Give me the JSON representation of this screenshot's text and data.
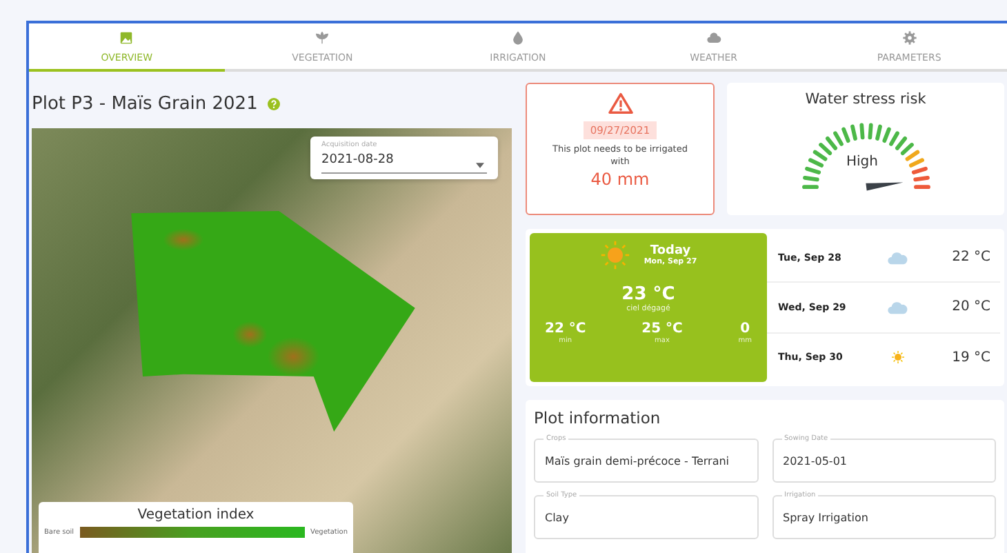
{
  "tabs": [
    {
      "label": "OVERVIEW",
      "selected": true
    },
    {
      "label": "VEGETATION",
      "selected": false
    },
    {
      "label": "IRRIGATION",
      "selected": false
    },
    {
      "label": "WEATHER",
      "selected": false
    },
    {
      "label": "PARAMETERS",
      "selected": false
    }
  ],
  "plot_title": "Plot P3 - Maïs Grain 2021",
  "map": {
    "acquisition_date": {
      "label": "Acquisition date",
      "value": "2021-08-28"
    },
    "legend": {
      "title": "Vegetation index",
      "low_label": "Bare soil",
      "high_label": "Vegetation"
    }
  },
  "alert": {
    "date": "09/27/2021",
    "message": "This plot needs to be irrigated with",
    "amount": "40 mm"
  },
  "water_stress": {
    "title": "Water stress risk",
    "reading": "High"
  },
  "weather": {
    "today": {
      "title": "Today",
      "date": "Mon, Sep 27",
      "kind": "sunny",
      "temperature": "23 °C",
      "condition": "ciel dégagé",
      "stats": [
        {
          "value": "22 °C",
          "label": "min"
        },
        {
          "value": "25 °C",
          "label": "max"
        },
        {
          "value": "0",
          "label": "mm"
        }
      ]
    },
    "forecast": [
      {
        "day": "Tue, Sep 28",
        "kind": "cloudy",
        "temperature": "22 °C"
      },
      {
        "day": "Wed, Sep 29",
        "kind": "cloudy",
        "temperature": "20 °C"
      },
      {
        "day": "Thu, Sep 30",
        "kind": "sunny",
        "temperature": "19 °C"
      }
    ]
  },
  "plot_information": {
    "title": "Plot information",
    "fields": [
      {
        "label": "Crops",
        "value": "Maïs grain demi-précoce - Terrani"
      },
      {
        "label": "Sowing Date",
        "value": "2021-05-01"
      },
      {
        "label": "Soil Type",
        "value": "Clay"
      },
      {
        "label": "Irrigation",
        "value": "Spray Irrigation"
      }
    ]
  }
}
